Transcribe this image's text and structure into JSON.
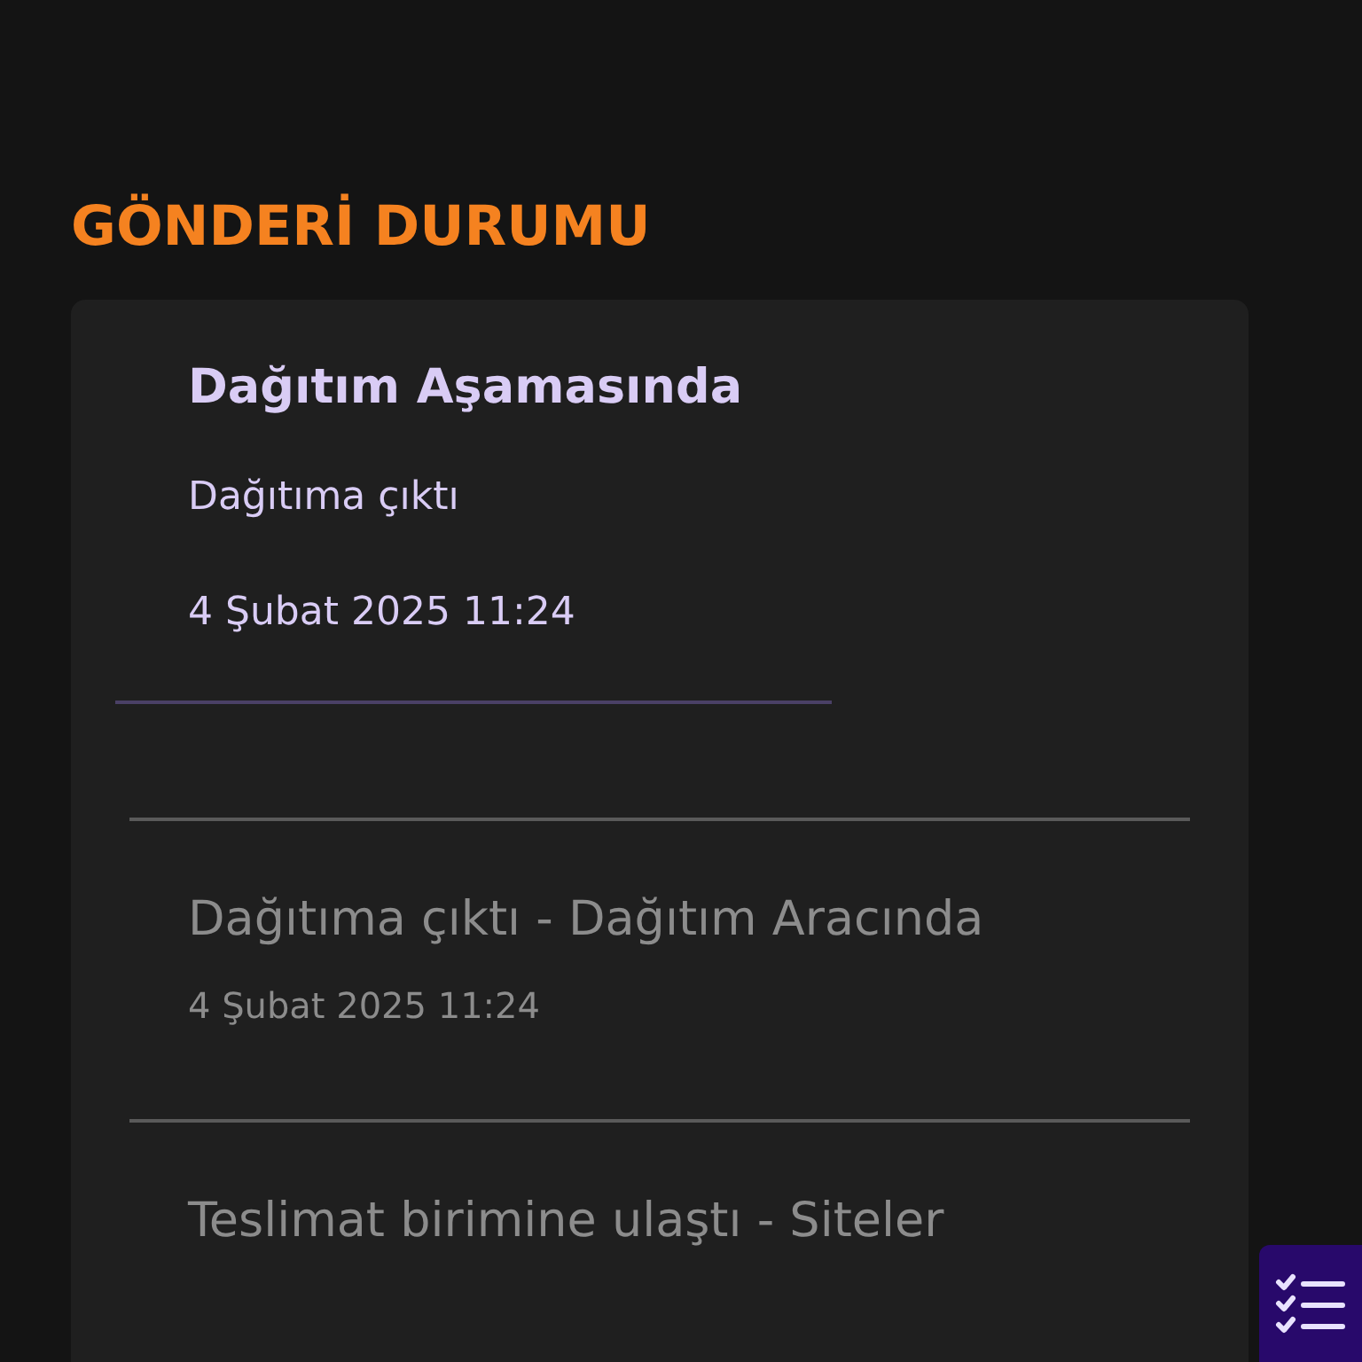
{
  "section_title": "GÖNDERİ DURUMU",
  "current_status": {
    "title": "Dağıtım Aşamasında",
    "description": "Dağıtıma çıktı",
    "date": "4 Şubat 2025 11:24"
  },
  "history": [
    {
      "title": "Dağıtıma çıktı - Dağıtım Aracında",
      "date": "4 Şubat 2025 11:24"
    },
    {
      "title": "Teslimat birimine ulaştı - Siteler"
    }
  ]
}
